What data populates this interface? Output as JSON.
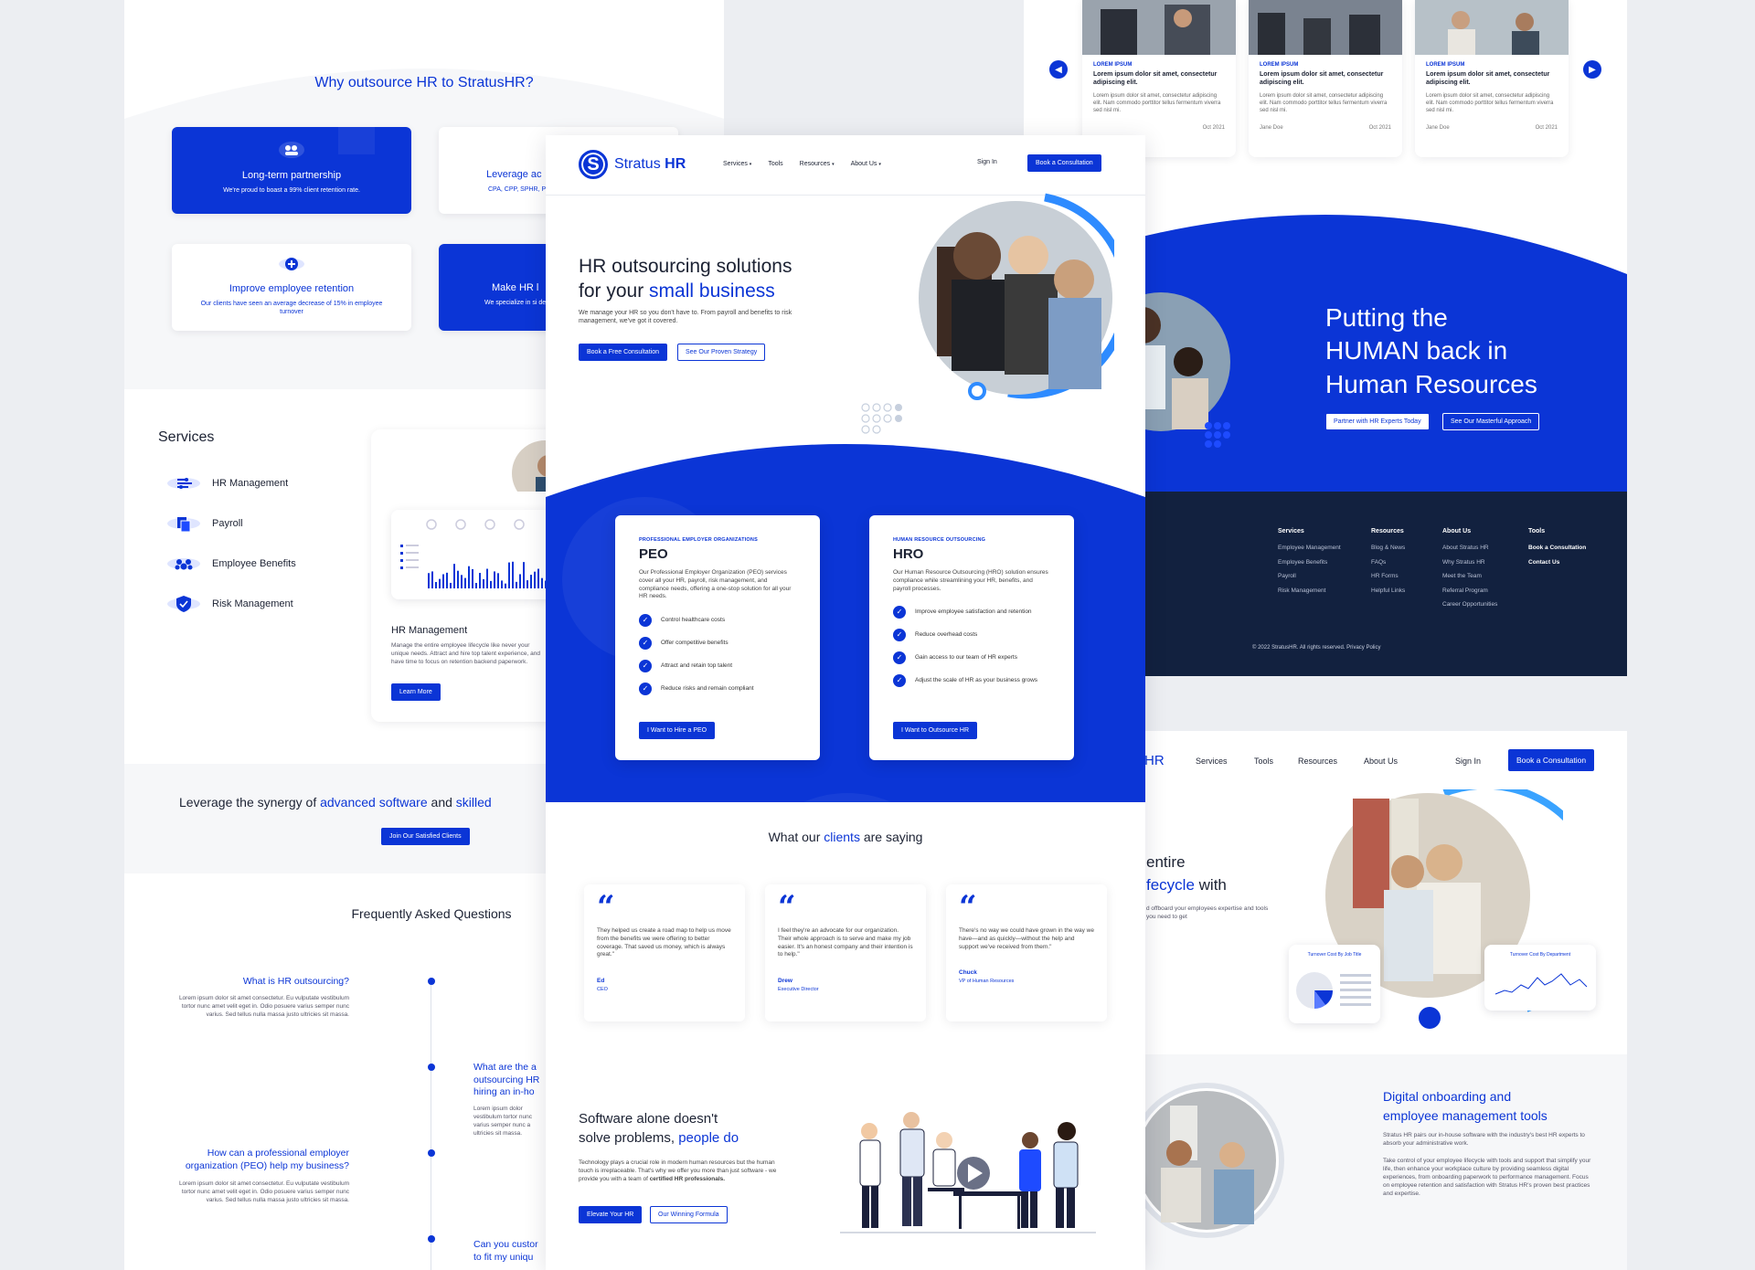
{
  "brand": {
    "logo_letter": "S",
    "name_part1": "Stratus",
    "name_part2": "HR",
    "primary": "#0b35d6",
    "navy": "#12213f"
  },
  "nav": {
    "services": "Services",
    "tools": "Tools",
    "resources": "Resources",
    "about": "About Us",
    "sign_in": "Sign In",
    "book": "Book a Consultation"
  },
  "why": {
    "title": "Why outsource HR to StratusHR?",
    "cards": [
      {
        "title": "Long-term partnership",
        "subtitle": "We're proud to boast a 99% client retention rate."
      },
      {
        "title": "Leverage ac",
        "subtitle": "CPA, CPP, SPHR, P"
      },
      {
        "title": "Improve employee retention",
        "subtitle": "Our clients have seen an average decrease of 15% in employee turnover"
      },
      {
        "title": "Make HR l",
        "subtitle": "We specialize in si delivering"
      }
    ]
  },
  "services": {
    "title": "Services",
    "items": [
      "HR Management",
      "Payroll",
      "Employee Benefits",
      "Risk Management"
    ],
    "card": {
      "title": "HR Management",
      "text": "Manage the entire employee lifecycle like never your unique needs. Attract and hire top talent experience, and have time to focus on retention backend paperwork.",
      "button": "Learn More"
    }
  },
  "leverage": {
    "title_part1": "Leverage the synergy of",
    "title_accent": "advanced software",
    "title_part2": "and",
    "title_accent2": "skilled",
    "button": "Join Our Satisfied Clients"
  },
  "faq": {
    "title": "Frequently Asked Questions",
    "items": [
      {
        "q": "What is HR outsourcing?",
        "a": "Lorem ipsum dolor sit amet consectetur. Eu vulputate vestibulum tortor nunc amet velit eget in. Odio posuere varius semper nunc varius. Sed tellus nulla massa justo ultricies sit massa."
      },
      {
        "q": "What are the a outsourcing HR hiring an in-ho",
        "a": "Lorem ipsum dolor vestibulum tortor nunc varius semper nunc a ultricies sit massa."
      },
      {
        "q": "How can a professional employer organization (PEO) help my business?",
        "a": "Lorem ipsum dolor sit amet consectetur. Eu vulputate vestibulum tortor nunc amet velit eget in. Odio posuere varius semper nunc varius. Sed tellus nulla massa justo ultricies sit massa."
      },
      {
        "q": "Can you custor to fit my uniqu",
        "a": ""
      }
    ]
  },
  "hero": {
    "line1": "HR outsourcing solutions",
    "line2_prefix": "for your",
    "line2_accent": "small business",
    "sub": "We manage your HR so you don't have to. From payroll and benefits to risk management, we've got it covered.",
    "btn_primary": "Book a Free Consultation",
    "btn_secondary": "See Our Proven Strategy"
  },
  "peo": {
    "tag": "PROFESSIONAL EMPLOYER ORGANIZATIONS",
    "title": "PEO",
    "desc": "Our Professional Employer Organization (PEO) services cover all your HR, payroll, risk management, and compliance needs, offering a one-stop solution for all your HR needs.",
    "checks": [
      "Control healthcare costs",
      "Offer competitive benefits",
      "Attract and retain top talent",
      "Reduce risks and remain compliant"
    ],
    "button": "I Want to Hire a PEO"
  },
  "hro": {
    "tag": "HUMAN RESOURCE OUTSOURCING",
    "title": "HRO",
    "desc": "Our Human Resource Outsourcing (HRO) solution ensures compliance while streamlining your HR, benefits, and payroll processes.",
    "checks": [
      "Improve employee satisfaction and retention",
      "Reduce overhead costs",
      "Gain access to our team of HR experts",
      "Adjust the scale of HR as your business grows"
    ],
    "button": "I Want to Outsource HR"
  },
  "testimonials": {
    "title_prefix": "What our",
    "title_accent": "clients",
    "title_suffix": "are saying",
    "items": [
      {
        "quote": "They helped us create a road map to help us move from the benefits we were offering to better coverage. That saved us money, which is always great.\"",
        "name": "Ed",
        "role": "CEO"
      },
      {
        "quote": "I feel they're an advocate for our organization. Their whole approach is to serve and make my job easier. It's an honest company and their intention is to help.\"",
        "name": "Drew",
        "role": "Executive Director"
      },
      {
        "quote": "There's no way we could have grown in the way we have—and as quickly—without the help and support we've received from them.\"",
        "name": "Chuck",
        "role": "VP of Human Resources"
      }
    ]
  },
  "software": {
    "line1": "Software alone doesn't",
    "line2_prefix": "solve problems,",
    "line2_accent": "people do",
    "text_prefix": "Technology plays a crucial role in modern human resources but the human touch is irreplaceable. That's why we offer you more than just software - we provide you with a team of",
    "text_bold": "certified HR professionals.",
    "btn_primary": "Elevate Your HR",
    "btn_secondary": "Our Winning Formula"
  },
  "blog": {
    "items": [
      {
        "tag": "LOREM IPSUM",
        "title": "Lorem ipsum dolor sit amet, consectetur adipiscing elit.",
        "text": "Lorem ipsum dolor sit amet, consectetur adipiscing elit. Nam commodo porttitor tellus fermentum viverra sed nisl mi.",
        "author": "",
        "date": "Oct 2021"
      },
      {
        "tag": "LOREM IPSUM",
        "title": "Lorem ipsum dolor sit amet, consectetur adipiscing elit.",
        "text": "Lorem ipsum dolor sit amet, consectetur adipiscing elit. Nam commodo porttitor tellus fermentum viverra sed nisl mi.",
        "author": "Jane Doe",
        "date": "Oct 2021"
      },
      {
        "tag": "LOREM IPSUM",
        "title": "Lorem ipsum dolor sit amet, consectetur adipiscing elit.",
        "text": "Lorem ipsum dolor sit amet, consectetur adipiscing elit. Nam commodo porttitor tellus fermentum viverra sed nisl mi.",
        "author": "Jane Doe",
        "date": "Oct 2021"
      }
    ]
  },
  "human": {
    "line1": "Putting the",
    "line2": "HUMAN back in",
    "line3": "Human Resources",
    "btn_primary": "Partner with HR Experts Today",
    "btn_secondary": "See Our Masterful Approach"
  },
  "footer": {
    "cols": [
      {
        "head": "Services",
        "links": [
          "Employee Management",
          "Employee Benefits",
          "Payroll",
          "Risk Management"
        ]
      },
      {
        "head": "Resources",
        "links": [
          "Blog & News",
          "FAQs",
          "HR Forms",
          "Helpful Links"
        ]
      },
      {
        "head": "About Us",
        "links": [
          "About Stratus HR",
          "Why Stratus HR",
          "Meet the Team",
          "Referral Program",
          "Career Opportunities"
        ]
      },
      {
        "head": "Tools",
        "links": [
          "Book a Consultation",
          "Contact Us"
        ]
      }
    ],
    "copyright": "© 2022 StratusHR. All rights reserved. Privacy Policy"
  },
  "lifecycle": {
    "line1": "entire",
    "line2_accent": "fecycle",
    "line2_suffix": "with",
    "text": "d offboard your employees expertise and tools you need to get",
    "widget1": "Turnover Cost By Job Title",
    "widget2": "Turnover Cost By Department"
  },
  "digital": {
    "line1": "Digital onboarding and",
    "line2": "employee management tools",
    "p1": "Stratus HR pairs our in-house software with the industry's best HR experts to absorb your administrative work.",
    "p2": "Take control of your employee lifecycle with tools and support that simplify your life, then enhance your workplace culture by providing seamless digital experiences, from onboarding paperwork to performance management. Focus on employee retention and satisfaction with Stratus HR's proven best practices and expertise."
  }
}
